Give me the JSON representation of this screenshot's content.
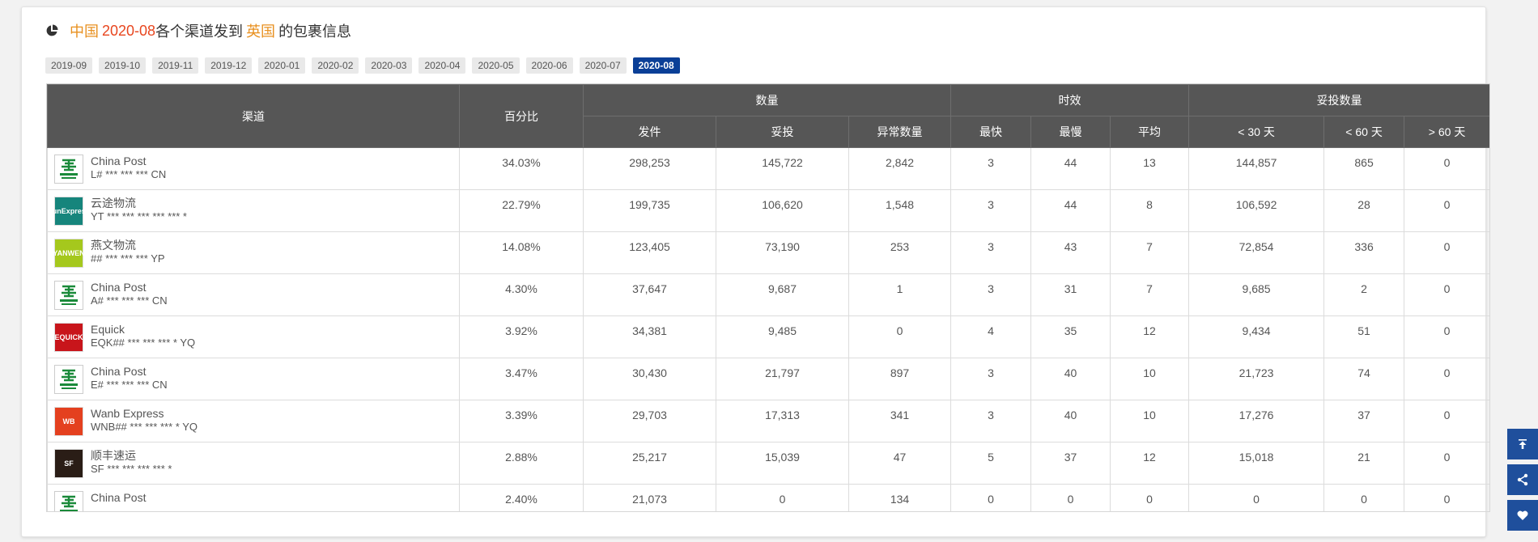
{
  "header": {
    "part1": "中国",
    "part2": "2020-08",
    "part3": "各个渠道发到",
    "part4": "英国",
    "part5": "的包裹信息"
  },
  "months": [
    "2019-09",
    "2019-10",
    "2019-11",
    "2019-12",
    "2020-01",
    "2020-02",
    "2020-03",
    "2020-04",
    "2020-05",
    "2020-06",
    "2020-07",
    "2020-08"
  ],
  "active_month": "2020-08",
  "table": {
    "h_channel": "渠道",
    "h_percent": "百分比",
    "h_quantity": "数量",
    "h_timeliness": "时效",
    "h_delivered_count": "妥投数量",
    "h_sent": "发件",
    "h_delivered": "妥投",
    "h_abnormal": "异常数量",
    "h_fastest": "最快",
    "h_slowest": "最慢",
    "h_average": "平均",
    "h_lt30": "< 30 天",
    "h_lt60": "< 60 天",
    "h_gt60": "> 60 天",
    "rows": [
      {
        "logo": "china-post",
        "name": "China Post",
        "tracking": "L# *** *** *** CN",
        "percent": "34.03%",
        "sent": "298,253",
        "delivered": "145,722",
        "abnormal": "2,842",
        "fastest": "3",
        "slowest": "44",
        "average": "13",
        "lt30": "144,857",
        "lt60": "865",
        "gt60": "0"
      },
      {
        "logo": "yuntu",
        "name": "云途物流",
        "tracking": "YT *** *** *** *** *** *",
        "percent": "22.79%",
        "sent": "199,735",
        "delivered": "106,620",
        "abnormal": "1,548",
        "fastest": "3",
        "slowest": "44",
        "average": "8",
        "lt30": "106,592",
        "lt60": "28",
        "gt60": "0"
      },
      {
        "logo": "yanwen",
        "name": "燕文物流",
        "tracking": "## *** *** *** YP",
        "percent": "14.08%",
        "sent": "123,405",
        "delivered": "73,190",
        "abnormal": "253",
        "fastest": "3",
        "slowest": "43",
        "average": "7",
        "lt30": "72,854",
        "lt60": "336",
        "gt60": "0"
      },
      {
        "logo": "china-post",
        "name": "China Post",
        "tracking": "A# *** *** *** CN",
        "percent": "4.30%",
        "sent": "37,647",
        "delivered": "9,687",
        "abnormal": "1",
        "fastest": "3",
        "slowest": "31",
        "average": "7",
        "lt30": "9,685",
        "lt60": "2",
        "gt60": "0"
      },
      {
        "logo": "equick",
        "name": "Equick",
        "tracking": "EQK## *** *** *** * YQ",
        "percent": "3.92%",
        "sent": "34,381",
        "delivered": "9,485",
        "abnormal": "0",
        "fastest": "4",
        "slowest": "35",
        "average": "12",
        "lt30": "9,434",
        "lt60": "51",
        "gt60": "0"
      },
      {
        "logo": "china-post",
        "name": "China Post",
        "tracking": "E# *** *** *** CN",
        "percent": "3.47%",
        "sent": "30,430",
        "delivered": "21,797",
        "abnormal": "897",
        "fastest": "3",
        "slowest": "40",
        "average": "10",
        "lt30": "21,723",
        "lt60": "74",
        "gt60": "0"
      },
      {
        "logo": "wanb",
        "name": "Wanb Express",
        "tracking": "WNB## *** *** *** * YQ",
        "percent": "3.39%",
        "sent": "29,703",
        "delivered": "17,313",
        "abnormal": "341",
        "fastest": "3",
        "slowest": "40",
        "average": "10",
        "lt30": "17,276",
        "lt60": "37",
        "gt60": "0"
      },
      {
        "logo": "sf",
        "name": "顺丰速运",
        "tracking": "SF *** *** *** *** *",
        "percent": "2.88%",
        "sent": "25,217",
        "delivered": "15,039",
        "abnormal": "47",
        "fastest": "5",
        "slowest": "37",
        "average": "12",
        "lt30": "15,018",
        "lt60": "21",
        "gt60": "0"
      },
      {
        "logo": "china-post",
        "name": "China Post",
        "tracking": "",
        "percent": "2.40%",
        "sent": "21,073",
        "delivered": "0",
        "abnormal": "134",
        "fastest": "0",
        "slowest": "0",
        "average": "0",
        "lt30": "0",
        "lt60": "0",
        "gt60": "0"
      }
    ]
  },
  "logos": {
    "china-post": {
      "bg": "#ffffff",
      "fg": "#1a8a3a",
      "text": ""
    },
    "yuntu": {
      "bg": "#16857c",
      "fg": "#ffffff",
      "text": "YunExpress"
    },
    "yanwen": {
      "bg": "#a5c81d",
      "fg": "#ffffff",
      "text": "YANWEN"
    },
    "equick": {
      "bg": "#c8151b",
      "fg": "#ffffff",
      "text": "EQUICK"
    },
    "wanb": {
      "bg": "#e4401f",
      "fg": "#ffffff",
      "text": "WB"
    },
    "sf": {
      "bg": "#2a1d16",
      "fg": "#ffffff",
      "text": "SF"
    }
  },
  "side_buttons": [
    "back-to-top-icon",
    "share-icon",
    "heart-icon"
  ],
  "colors": {
    "header_bg": "#565656",
    "active_chip": "#0a3f97",
    "side_button": "#1f4f9c",
    "highlight_red": "#e8461f",
    "highlight_orange": "#e8901f"
  }
}
